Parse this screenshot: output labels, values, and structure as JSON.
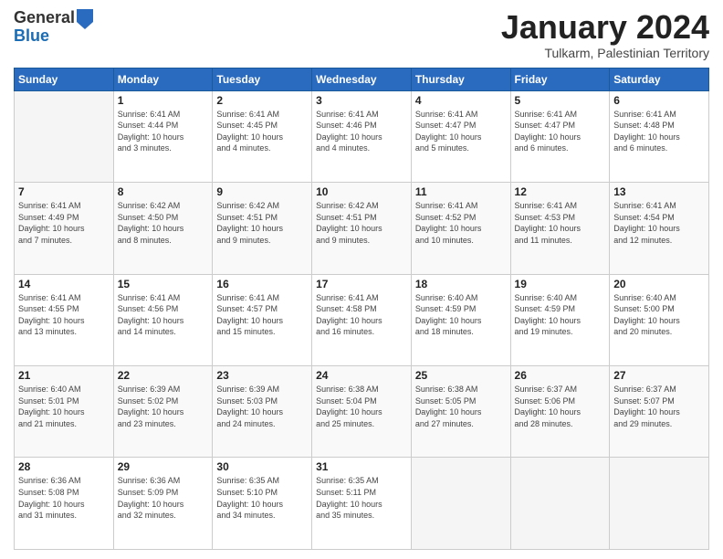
{
  "header": {
    "logo_general": "General",
    "logo_blue": "Blue",
    "month_title": "January 2024",
    "location": "Tulkarm, Palestinian Territory"
  },
  "weekdays": [
    "Sunday",
    "Monday",
    "Tuesday",
    "Wednesday",
    "Thursday",
    "Friday",
    "Saturday"
  ],
  "weeks": [
    [
      {
        "day": "",
        "info": ""
      },
      {
        "day": "1",
        "info": "Sunrise: 6:41 AM\nSunset: 4:44 PM\nDaylight: 10 hours\nand 3 minutes."
      },
      {
        "day": "2",
        "info": "Sunrise: 6:41 AM\nSunset: 4:45 PM\nDaylight: 10 hours\nand 4 minutes."
      },
      {
        "day": "3",
        "info": "Sunrise: 6:41 AM\nSunset: 4:46 PM\nDaylight: 10 hours\nand 4 minutes."
      },
      {
        "day": "4",
        "info": "Sunrise: 6:41 AM\nSunset: 4:47 PM\nDaylight: 10 hours\nand 5 minutes."
      },
      {
        "day": "5",
        "info": "Sunrise: 6:41 AM\nSunset: 4:47 PM\nDaylight: 10 hours\nand 6 minutes."
      },
      {
        "day": "6",
        "info": "Sunrise: 6:41 AM\nSunset: 4:48 PM\nDaylight: 10 hours\nand 6 minutes."
      }
    ],
    [
      {
        "day": "7",
        "info": "Sunrise: 6:41 AM\nSunset: 4:49 PM\nDaylight: 10 hours\nand 7 minutes."
      },
      {
        "day": "8",
        "info": "Sunrise: 6:42 AM\nSunset: 4:50 PM\nDaylight: 10 hours\nand 8 minutes."
      },
      {
        "day": "9",
        "info": "Sunrise: 6:42 AM\nSunset: 4:51 PM\nDaylight: 10 hours\nand 9 minutes."
      },
      {
        "day": "10",
        "info": "Sunrise: 6:42 AM\nSunset: 4:51 PM\nDaylight: 10 hours\nand 9 minutes."
      },
      {
        "day": "11",
        "info": "Sunrise: 6:41 AM\nSunset: 4:52 PM\nDaylight: 10 hours\nand 10 minutes."
      },
      {
        "day": "12",
        "info": "Sunrise: 6:41 AM\nSunset: 4:53 PM\nDaylight: 10 hours\nand 11 minutes."
      },
      {
        "day": "13",
        "info": "Sunrise: 6:41 AM\nSunset: 4:54 PM\nDaylight: 10 hours\nand 12 minutes."
      }
    ],
    [
      {
        "day": "14",
        "info": "Sunrise: 6:41 AM\nSunset: 4:55 PM\nDaylight: 10 hours\nand 13 minutes."
      },
      {
        "day": "15",
        "info": "Sunrise: 6:41 AM\nSunset: 4:56 PM\nDaylight: 10 hours\nand 14 minutes."
      },
      {
        "day": "16",
        "info": "Sunrise: 6:41 AM\nSunset: 4:57 PM\nDaylight: 10 hours\nand 15 minutes."
      },
      {
        "day": "17",
        "info": "Sunrise: 6:41 AM\nSunset: 4:58 PM\nDaylight: 10 hours\nand 16 minutes."
      },
      {
        "day": "18",
        "info": "Sunrise: 6:40 AM\nSunset: 4:59 PM\nDaylight: 10 hours\nand 18 minutes."
      },
      {
        "day": "19",
        "info": "Sunrise: 6:40 AM\nSunset: 4:59 PM\nDaylight: 10 hours\nand 19 minutes."
      },
      {
        "day": "20",
        "info": "Sunrise: 6:40 AM\nSunset: 5:00 PM\nDaylight: 10 hours\nand 20 minutes."
      }
    ],
    [
      {
        "day": "21",
        "info": "Sunrise: 6:40 AM\nSunset: 5:01 PM\nDaylight: 10 hours\nand 21 minutes."
      },
      {
        "day": "22",
        "info": "Sunrise: 6:39 AM\nSunset: 5:02 PM\nDaylight: 10 hours\nand 23 minutes."
      },
      {
        "day": "23",
        "info": "Sunrise: 6:39 AM\nSunset: 5:03 PM\nDaylight: 10 hours\nand 24 minutes."
      },
      {
        "day": "24",
        "info": "Sunrise: 6:38 AM\nSunset: 5:04 PM\nDaylight: 10 hours\nand 25 minutes."
      },
      {
        "day": "25",
        "info": "Sunrise: 6:38 AM\nSunset: 5:05 PM\nDaylight: 10 hours\nand 27 minutes."
      },
      {
        "day": "26",
        "info": "Sunrise: 6:37 AM\nSunset: 5:06 PM\nDaylight: 10 hours\nand 28 minutes."
      },
      {
        "day": "27",
        "info": "Sunrise: 6:37 AM\nSunset: 5:07 PM\nDaylight: 10 hours\nand 29 minutes."
      }
    ],
    [
      {
        "day": "28",
        "info": "Sunrise: 6:36 AM\nSunset: 5:08 PM\nDaylight: 10 hours\nand 31 minutes."
      },
      {
        "day": "29",
        "info": "Sunrise: 6:36 AM\nSunset: 5:09 PM\nDaylight: 10 hours\nand 32 minutes."
      },
      {
        "day": "30",
        "info": "Sunrise: 6:35 AM\nSunset: 5:10 PM\nDaylight: 10 hours\nand 34 minutes."
      },
      {
        "day": "31",
        "info": "Sunrise: 6:35 AM\nSunset: 5:11 PM\nDaylight: 10 hours\nand 35 minutes."
      },
      {
        "day": "",
        "info": ""
      },
      {
        "day": "",
        "info": ""
      },
      {
        "day": "",
        "info": ""
      }
    ]
  ]
}
